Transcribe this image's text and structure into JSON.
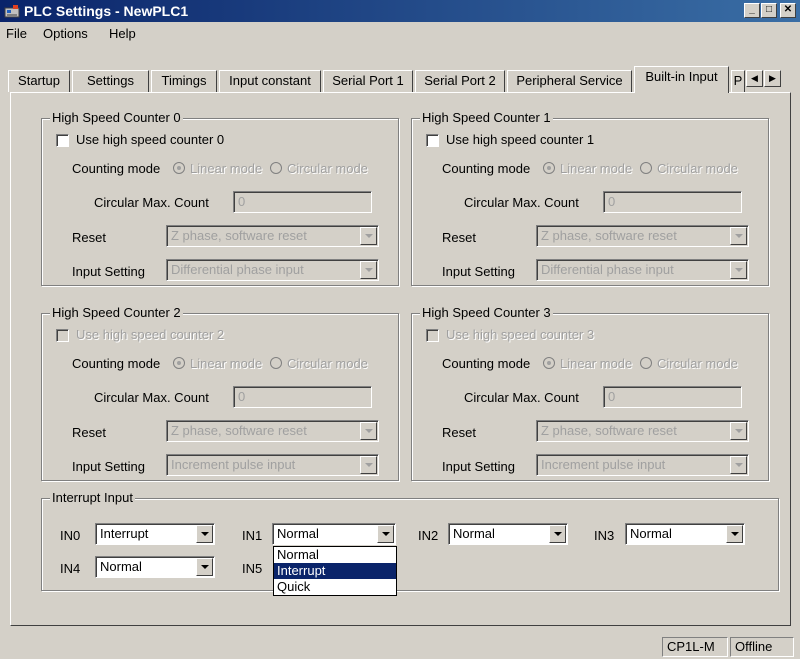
{
  "window": {
    "title": "PLC Settings - NewPLC1",
    "min_label": "_",
    "max_label": "□",
    "close_label": "✕"
  },
  "menu": [
    "File",
    "Options",
    "Help"
  ],
  "tabs": [
    "Startup",
    "Settings",
    "Timings",
    "Input constant",
    "Serial Port 1",
    "Serial Port 2",
    "Peripheral Service",
    "Built-in Input",
    "P"
  ],
  "tab_scroll": {
    "left": "◀",
    "right": "▶"
  },
  "counters": [
    {
      "title": "High Speed Counter 0",
      "use_label": "Use high speed counter 0",
      "enabled": true,
      "counting_mode_label": "Counting mode",
      "linear_label": "Linear mode",
      "circular_label": "Circular mode",
      "max_count_label": "Circular Max. Count",
      "max_count_value": "0",
      "reset_label": "Reset",
      "reset_value": "Z phase, software reset",
      "input_setting_label": "Input Setting",
      "input_setting_value": "Differential phase input"
    },
    {
      "title": "High Speed Counter 1",
      "use_label": "Use high speed counter 1",
      "enabled": true,
      "counting_mode_label": "Counting mode",
      "linear_label": "Linear mode",
      "circular_label": "Circular mode",
      "max_count_label": "Circular Max. Count",
      "max_count_value": "0",
      "reset_label": "Reset",
      "reset_value": "Z phase, software reset",
      "input_setting_label": "Input Setting",
      "input_setting_value": "Differential phase input"
    },
    {
      "title": "High Speed Counter 2",
      "use_label": "Use high speed counter 2",
      "enabled": false,
      "counting_mode_label": "Counting mode",
      "linear_label": "Linear mode",
      "circular_label": "Circular mode",
      "max_count_label": "Circular Max. Count",
      "max_count_value": "0",
      "reset_label": "Reset",
      "reset_value": "Z phase, software reset",
      "input_setting_label": "Input Setting",
      "input_setting_value": "Increment pulse input"
    },
    {
      "title": "High Speed Counter 3",
      "use_label": "Use high speed counter 3",
      "enabled": false,
      "counting_mode_label": "Counting mode",
      "linear_label": "Linear mode",
      "circular_label": "Circular mode",
      "max_count_label": "Circular Max. Count",
      "max_count_value": "0",
      "reset_label": "Reset",
      "reset_value": "Z phase, software reset",
      "input_setting_label": "Input Setting",
      "input_setting_value": "Increment pulse input"
    }
  ],
  "interrupt": {
    "title": "Interrupt Input",
    "inputs": [
      {
        "label": "IN0",
        "value": "Interrupt"
      },
      {
        "label": "IN1",
        "value": "Normal"
      },
      {
        "label": "IN2",
        "value": "Normal"
      },
      {
        "label": "IN3",
        "value": "Normal"
      },
      {
        "label": "IN4",
        "value": "Normal"
      },
      {
        "label": "IN5",
        "value": ""
      }
    ],
    "dropdown_options": [
      "Normal",
      "Interrupt",
      "Quick"
    ],
    "dropdown_selected": "Interrupt"
  },
  "status": {
    "model": "CP1L-M",
    "connection": "Offline"
  },
  "colors": {
    "titlebar_start": "#0a246a",
    "titlebar_end": "#3a6ea5",
    "face": "#d4d0c8",
    "selection": "#0a246a"
  }
}
